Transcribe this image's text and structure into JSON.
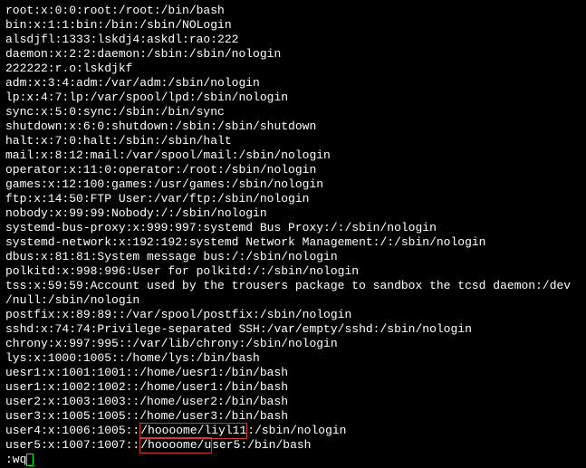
{
  "lines": [
    {
      "text": "root:x:0:0:root:/root:/bin/bash"
    },
    {
      "text": "bin:x:1:1:bin:/bin:/sbin/NOLogin"
    },
    {
      "text": "alsdjfl:1333:lskdj4:askdl:rao:222"
    },
    {
      "text": "daemon:x:2:2:daemon:/sbin:/sbin/nologin"
    },
    {
      "text": "222222:r.o:lskdjkf"
    },
    {
      "text": "adm:x:3:4:adm:/var/adm:/sbin/nologin"
    },
    {
      "text": "lp:x:4:7:lp:/var/spool/lpd:/sbin/nologin"
    },
    {
      "text": "sync:x:5:0:sync:/sbin:/bin/sync"
    },
    {
      "text": "shutdown:x:6:0:shutdown:/sbin:/sbin/shutdown"
    },
    {
      "text": "halt:x:7:0:halt:/sbin:/sbin/halt"
    },
    {
      "text": "mail:x:8:12:mail:/var/spool/mail:/sbin/nologin"
    },
    {
      "text": "operator:x:11:0:operator:/root:/sbin/nologin"
    },
    {
      "text": "games:x:12:100:games:/usr/games:/sbin/nologin"
    },
    {
      "text": "ftp:x:14:50:FTP User:/var/ftp:/sbin/nologin"
    },
    {
      "text": "nobody:x:99:99:Nobody:/:/sbin/nologin"
    },
    {
      "text": "systemd-bus-proxy:x:999:997:systemd Bus Proxy:/:/sbin/nologin"
    },
    {
      "text": "systemd-network:x:192:192:systemd Network Management:/:/sbin/nologin"
    },
    {
      "text": "dbus:x:81:81:System message bus:/:/sbin/nologin"
    },
    {
      "text": "polkitd:x:998:996:User for polkitd:/:/sbin/nologin"
    },
    {
      "text": "tss:x:59:59:Account used by the trousers package to sandbox the tcsd daemon:/dev"
    },
    {
      "text": "/null:/sbin/nologin"
    },
    {
      "text": "postfix:x:89:89::/var/spool/postfix:/sbin/nologin"
    },
    {
      "text": "sshd:x:74:74:Privilege-separated SSH:/var/empty/sshd:/sbin/nologin"
    },
    {
      "text": "chrony:x:997:995::/var/lib/chrony:/sbin/nologin"
    },
    {
      "text": "lys:x:1000:1005::/home/lys:/bin/bash"
    },
    {
      "text": "uesr1:x:1001:1001::/home/uesr1:/bin/bash"
    },
    {
      "text": "user1:x:1002:1002::/home/user1:/bin/bash"
    },
    {
      "text": "user2:x:1003:1003::/home/user2:/bin/bash"
    },
    {
      "text": "user3:x:1005:1005::/home/user3:/bin/bash"
    },
    {
      "pre": "user4:x:1006:1005::",
      "hl": "/hoooome/liyl11",
      "post": ":/sbin/nologin"
    },
    {
      "pre": "user5:x:1007:1007::",
      "hl": "/hoooome/u",
      "post": "ser5:/bin/bash"
    }
  ],
  "command": ":wq"
}
